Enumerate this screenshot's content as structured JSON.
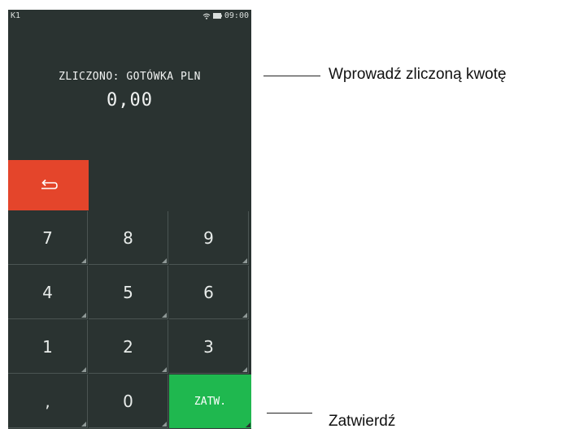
{
  "status_bar": {
    "left_label": "K1",
    "time": "09:00"
  },
  "display": {
    "label": "ZLICZONO: GOTÓWKA PLN",
    "amount": "0,00"
  },
  "back_button": {
    "icon": "return-arrow-icon"
  },
  "keypad": {
    "keys": [
      "7",
      "8",
      "9",
      "4",
      "5",
      "6",
      "1",
      "2",
      "3",
      ",",
      "0",
      "ZATW."
    ],
    "confirm_color": "#1fb84f",
    "back_color": "#e4452b"
  },
  "annotations": {
    "amount": "Wprowadź zliczoną kwotę",
    "confirm": "Zatwierdź"
  }
}
